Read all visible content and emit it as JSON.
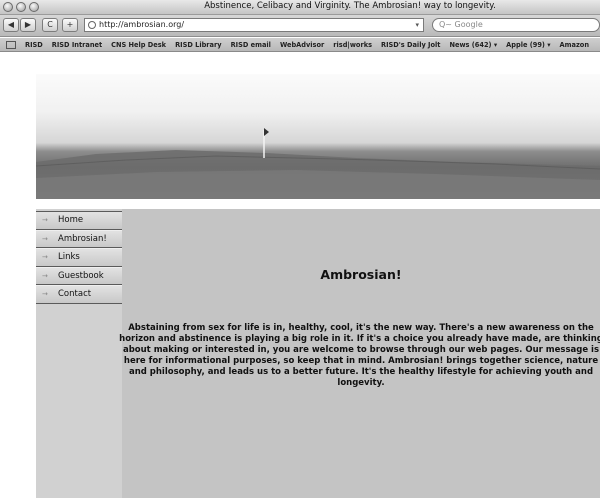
{
  "window": {
    "title": "Abstinence, Celibacy and Virginity. The Ambrosian! way to longevity."
  },
  "toolbar": {
    "back_label": "◀",
    "forward_label": "▶",
    "reload_label": "C",
    "add_label": "+",
    "url": "http://ambrosian.org/",
    "search_placeholder": "Q~ Google"
  },
  "bookmarks": [
    "RISD",
    "RISD Intranet",
    "CNS Help Desk",
    "RISD Library",
    "RISD email",
    "WebAdvisor",
    "risd|works",
    "RISD's Daily Jolt",
    "News (642) ▾",
    "Apple (99) ▾",
    "Amazon"
  ],
  "nav": {
    "items": [
      "Home",
      "Ambrosian!",
      "Links",
      "Guestbook",
      "Contact"
    ]
  },
  "main": {
    "heading": "Ambrosian!",
    "intro": "Abstaining from sex for life is in, healthy, cool, it's the new way. There's a new awareness on the horizon and abstinence is playing a big role in it. If it's a choice you already have made, are thinking about making or interested in, you are welcome to browse through our web pages. Our message is here for informational purposes, so keep that in mind. Ambrosian! brings together science, nature and philosophy, and leads us to a better future. It's the healthy lifestyle for achieving youth and longevity."
  }
}
